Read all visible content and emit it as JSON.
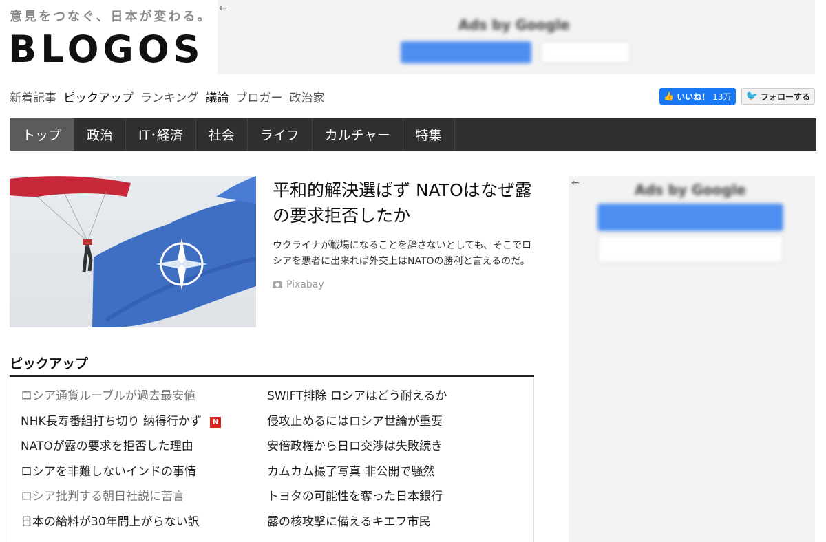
{
  "header": {
    "tagline": "意見をつなぐ、日本が変わる。",
    "logo": "BLOGOS"
  },
  "ads": {
    "back_arrow": "←",
    "top_blur_title": "Ads by Google",
    "side_blur_title": "Ads by Google"
  },
  "subnav": {
    "items": [
      "新着記事",
      "ピックアップ",
      "ランキング",
      "議論",
      "ブロガー",
      "政治家"
    ]
  },
  "social": {
    "like_label": "いいね！",
    "like_count": "13万",
    "follow_label": "フォローする"
  },
  "mainnav": {
    "items": [
      "トップ",
      "政治",
      "IT･経済",
      "社会",
      "ライフ",
      "カルチャー",
      "特集"
    ]
  },
  "hero": {
    "title": "平和的解決選ばず NATOはなぜ露の要求拒否したか",
    "description": "ウクライナが戦場になることを辞さないとしても、そこでロシアを悪者に出来れば外交上はNATOの勝利と言えるのだ。",
    "credit": "Pixabay"
  },
  "pickup": {
    "heading": "ピックアップ",
    "new_badge": "N",
    "left": [
      {
        "text": "ロシア通貨ルーブルが過去最安値",
        "visited": true
      },
      {
        "text": "NHK長寿番組打ち切り 納得行かず",
        "visited": false,
        "new": true
      },
      {
        "text": "NATOが露の要求を拒否した理由",
        "visited": false
      },
      {
        "text": "ロシアを非難しないインドの事情",
        "visited": false
      },
      {
        "text": "ロシア批判する朝日社説に苦言",
        "visited": true
      },
      {
        "text": "日本の給料が30年間上がらない訳",
        "visited": false
      }
    ],
    "right": [
      {
        "text": "SWIFT排除 ロシアはどう耐えるか"
      },
      {
        "text": "侵攻止めるにはロシア世論が重要"
      },
      {
        "text": "安倍政権から日ロ交渉は失敗続き"
      },
      {
        "text": "カムカム撮了写真 非公開で騒然"
      },
      {
        "text": "トヨタの可能性を奪った日本銀行"
      },
      {
        "text": "露の核攻撃に備えるキエフ市民"
      }
    ]
  }
}
